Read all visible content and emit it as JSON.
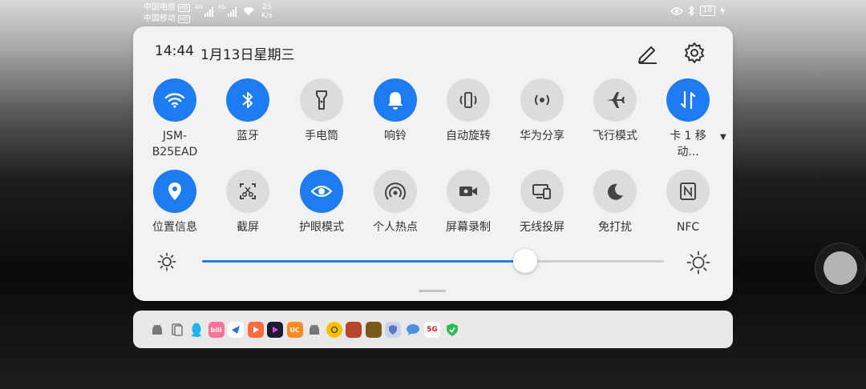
{
  "status_bar": {
    "carrier1": "中国电信",
    "carrier2": "中国移动",
    "hd_badge": "HD",
    "network_type": "4G",
    "speed_value": "23",
    "speed_unit": "K/s",
    "battery": "18"
  },
  "panel": {
    "time": "14:44",
    "date": "1月13日星期三",
    "edit_icon": "pencil-icon",
    "settings_icon": "gear-icon"
  },
  "tiles_row1": [
    {
      "label": "JSM-B25EAD",
      "icon": "wifi-icon",
      "on": true
    },
    {
      "label": "蓝牙",
      "icon": "bluetooth-icon",
      "on": true
    },
    {
      "label": "手电筒",
      "icon": "flashlight-icon",
      "on": false
    },
    {
      "label": "响铃",
      "icon": "bell-icon",
      "on": true
    },
    {
      "label": "自动旋转",
      "icon": "auto-rotate-icon",
      "on": false
    },
    {
      "label": "华为分享",
      "icon": "huawei-share-icon",
      "on": false
    },
    {
      "label": "飞行模式",
      "icon": "airplane-icon",
      "on": false
    },
    {
      "label": "卡 1 移动...",
      "icon": "mobile-data-icon",
      "on": true
    }
  ],
  "tiles_row2": [
    {
      "label": "位置信息",
      "icon": "location-icon",
      "on": true
    },
    {
      "label": "截屏",
      "icon": "screenshot-icon",
      "on": false
    },
    {
      "label": "护眼模式",
      "icon": "eye-icon",
      "on": true
    },
    {
      "label": "个人热点",
      "icon": "hotspot-icon",
      "on": false
    },
    {
      "label": "屏幕录制",
      "icon": "screen-record-icon",
      "on": false
    },
    {
      "label": "无线投屏",
      "icon": "wireless-projection-icon",
      "on": false
    },
    {
      "label": "免打扰",
      "icon": "moon-icon",
      "on": false
    },
    {
      "label": "NFC",
      "icon": "nfc-icon",
      "on": false
    }
  ],
  "brightness": {
    "level": 0.7,
    "low_icon": "sun-low-icon",
    "high_icon": "sun-high-icon"
  },
  "notification_icons": [
    "android-icon",
    "file-icon",
    "qq-icon",
    "bilibili-icon",
    "app-icon",
    "video-icon",
    "video-icon",
    "uc-browser-icon",
    "android-icon",
    "coin-icon",
    "game-icon",
    "game-icon",
    "shield-icon",
    "chat-icon",
    "5g-icon",
    "security-icon"
  ],
  "colors": {
    "accent": "#1e7cf2",
    "tile_off": "#dcdcdc",
    "panel_bg": "#f2f2f2"
  }
}
